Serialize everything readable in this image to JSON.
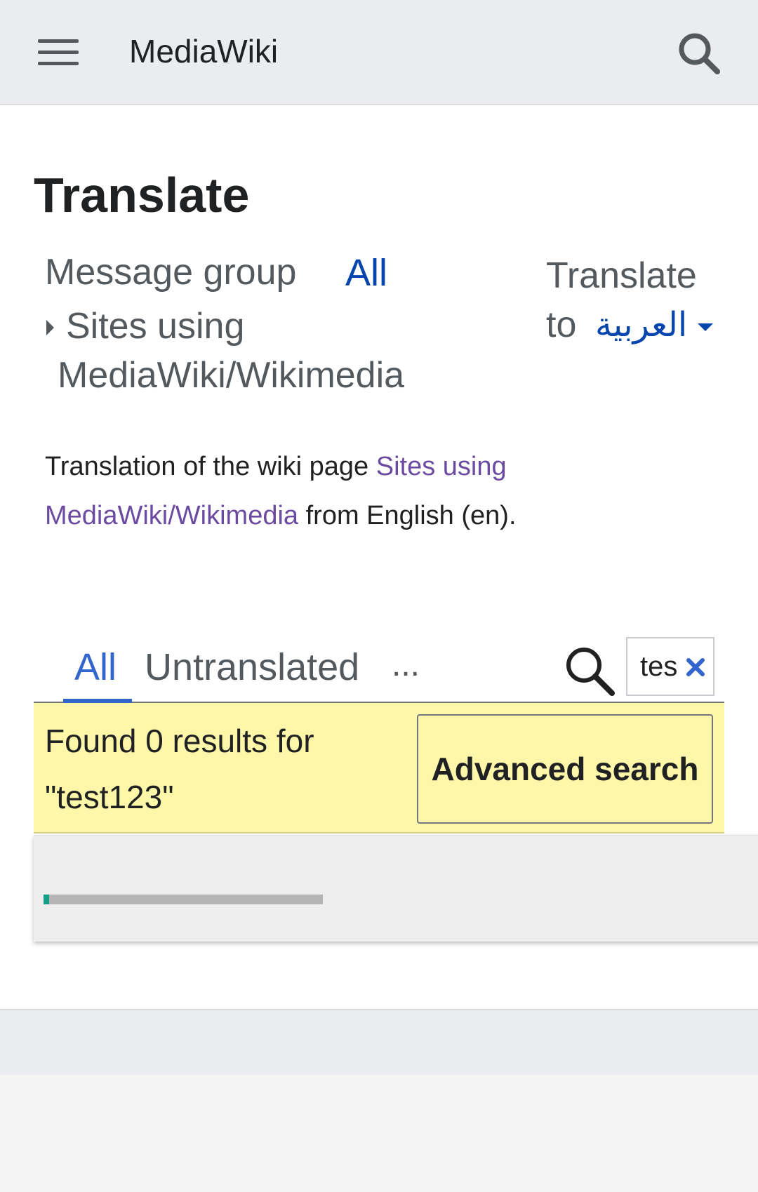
{
  "header": {
    "site_title": "MediaWiki",
    "menu_icon": "hamburger-menu-icon",
    "search_icon": "search-icon"
  },
  "page": {
    "title": "Translate"
  },
  "message_group": {
    "label": "Message group",
    "selected": "All",
    "subgroup_line1": "Sites using",
    "subgroup_line2": "MediaWiki/Wikimedia"
  },
  "translate_to": {
    "label_line1": "Translate",
    "label_line2": "to",
    "language": "العربية"
  },
  "description": {
    "prefix": "Translation of the wiki page ",
    "link_text": "Sites using MediaWiki/Wikimedia",
    "suffix": " from English (en)."
  },
  "filter_tabs": {
    "all": "All",
    "untranslated": "Untranslated",
    "more": "..."
  },
  "search": {
    "value": "test123",
    "visible_value": "tes"
  },
  "results": {
    "message": "Found 0 results for \"test123\"",
    "advanced_search_label": "Advanced search"
  },
  "loader": {
    "progress_fraction": 0.02
  },
  "colors": {
    "link_blue": "#3366cc",
    "visited_link": "#6b4ba1",
    "result_bar": "#fef6a9",
    "progress": "#14a085"
  }
}
